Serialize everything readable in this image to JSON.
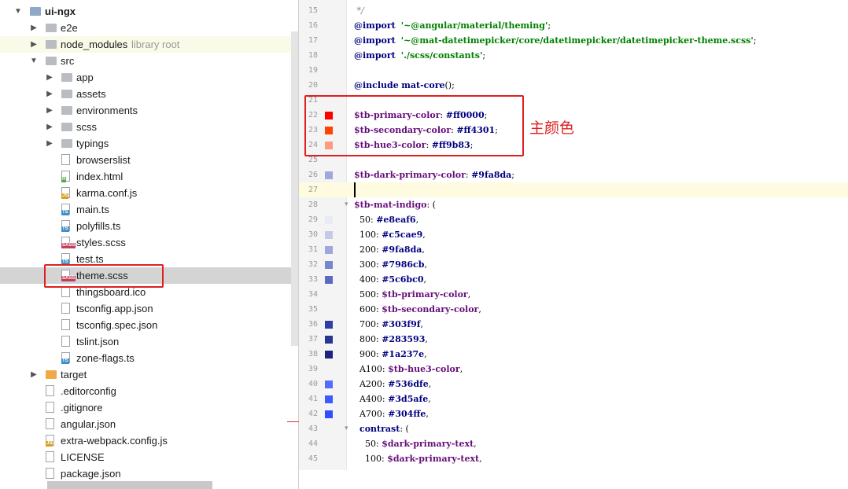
{
  "tree": {
    "rows": [
      {
        "label": "ui-ngx",
        "hint": "",
        "type": "root",
        "depth": 0,
        "arrow": "down",
        "bold": true
      },
      {
        "label": "e2e",
        "hint": "",
        "type": "folder",
        "depth": 1,
        "arrow": "right"
      },
      {
        "label": "node_modules",
        "hint": "library root",
        "type": "folder",
        "depth": 1,
        "arrow": "right"
      },
      {
        "label": "src",
        "hint": "",
        "type": "folder",
        "depth": 1,
        "arrow": "down"
      },
      {
        "label": "app",
        "hint": "",
        "type": "folder",
        "depth": 2,
        "arrow": "right"
      },
      {
        "label": "assets",
        "hint": "",
        "type": "folder",
        "depth": 2,
        "arrow": "right"
      },
      {
        "label": "environments",
        "hint": "",
        "type": "folder",
        "depth": 2,
        "arrow": "right"
      },
      {
        "label": "scss",
        "hint": "",
        "type": "folder",
        "depth": 2,
        "arrow": "right"
      },
      {
        "label": "typings",
        "hint": "",
        "type": "folder",
        "depth": 2,
        "arrow": "right"
      },
      {
        "label": "browserslist",
        "hint": "",
        "type": "file",
        "depth": 2,
        "arrow": "",
        "badge": "",
        "badgeColor": ""
      },
      {
        "label": "index.html",
        "hint": "",
        "type": "file",
        "depth": 2,
        "arrow": "",
        "badge": "H",
        "badgeColor": "#5aa845"
      },
      {
        "label": "karma.conf.js",
        "hint": "",
        "type": "file",
        "depth": 2,
        "arrow": "",
        "badge": "JS",
        "badgeColor": "#d8a020"
      },
      {
        "label": "main.ts",
        "hint": "",
        "type": "file",
        "depth": 2,
        "arrow": "",
        "badge": "TS",
        "badgeColor": "#3f8fc8"
      },
      {
        "label": "polyfills.ts",
        "hint": "",
        "type": "file",
        "depth": 2,
        "arrow": "",
        "badge": "TS",
        "badgeColor": "#3f8fc8"
      },
      {
        "label": "styles.scss",
        "hint": "",
        "type": "file",
        "depth": 2,
        "arrow": "",
        "badge": "SASS",
        "badgeColor": "#c0405a"
      },
      {
        "label": "test.ts",
        "hint": "",
        "type": "file",
        "depth": 2,
        "arrow": "",
        "badge": "TS",
        "badgeColor": "#3f8fc8"
      },
      {
        "label": "theme.scss",
        "hint": "",
        "type": "file",
        "depth": 2,
        "arrow": "",
        "badge": "SASS",
        "badgeColor": "#c0405a",
        "selected": true
      },
      {
        "label": "thingsboard.ico",
        "hint": "",
        "type": "file",
        "depth": 2,
        "arrow": "",
        "badge": "",
        "badgeColor": ""
      },
      {
        "label": "tsconfig.app.json",
        "hint": "",
        "type": "file",
        "depth": 2,
        "arrow": "",
        "badge": "",
        "badgeColor": ""
      },
      {
        "label": "tsconfig.spec.json",
        "hint": "",
        "type": "file",
        "depth": 2,
        "arrow": "",
        "badge": "",
        "badgeColor": ""
      },
      {
        "label": "tslint.json",
        "hint": "",
        "type": "file",
        "depth": 2,
        "arrow": "",
        "badge": "",
        "badgeColor": ""
      },
      {
        "label": "zone-flags.ts",
        "hint": "",
        "type": "file",
        "depth": 2,
        "arrow": "",
        "badge": "TS",
        "badgeColor": "#3f8fc8"
      },
      {
        "label": "target",
        "hint": "",
        "type": "folder-orange",
        "depth": 1,
        "arrow": "right"
      },
      {
        "label": ".editorconfig",
        "hint": "",
        "type": "file",
        "depth": 1,
        "arrow": "",
        "badge": "",
        "badgeColor": ""
      },
      {
        "label": ".gitignore",
        "hint": "",
        "type": "file",
        "depth": 1,
        "arrow": "",
        "badge": "",
        "badgeColor": ""
      },
      {
        "label": "angular.json",
        "hint": "",
        "type": "file",
        "depth": 1,
        "arrow": "",
        "badge": "",
        "badgeColor": ""
      },
      {
        "label": "extra-webpack.config.js",
        "hint": "",
        "type": "file",
        "depth": 1,
        "arrow": "",
        "badge": "JS",
        "badgeColor": "#d8a020"
      },
      {
        "label": "LICENSE",
        "hint": "",
        "type": "file",
        "depth": 1,
        "arrow": "",
        "badge": "",
        "badgeColor": ""
      },
      {
        "label": "package.json",
        "hint": "",
        "type": "file",
        "depth": 1,
        "arrow": "",
        "badge": "",
        "badgeColor": ""
      }
    ]
  },
  "editor": {
    "lines": [
      {
        "n": "15",
        "swatch": "",
        "fold": "",
        "tokens": [
          [
            "cm",
            " */"
          ]
        ]
      },
      {
        "n": "16",
        "swatch": "",
        "fold": "",
        "tokens": [
          [
            "kw",
            "@import"
          ],
          [
            "",
            "  "
          ],
          [
            "str",
            "'~@angular/material/theming'"
          ],
          [
            "",
            ";"
          ]
        ]
      },
      {
        "n": "17",
        "swatch": "",
        "fold": "",
        "tokens": [
          [
            "kw",
            "@import"
          ],
          [
            "",
            "  "
          ],
          [
            "str",
            "'~@mat-datetimepicker/core/datetimepicker/datetimepicker-theme.scss'"
          ],
          [
            "",
            ";"
          ]
        ]
      },
      {
        "n": "18",
        "swatch": "",
        "fold": "",
        "tokens": [
          [
            "kw",
            "@import"
          ],
          [
            "",
            "  "
          ],
          [
            "str",
            "'./scss/constants'"
          ],
          [
            "",
            ";"
          ]
        ]
      },
      {
        "n": "19",
        "swatch": "",
        "fold": "",
        "tokens": []
      },
      {
        "n": "20",
        "swatch": "",
        "fold": "",
        "tokens": [
          [
            "kw",
            "@include"
          ],
          [
            "",
            " "
          ],
          [
            "kw",
            "mat-core"
          ],
          [
            "",
            "();"
          ]
        ]
      },
      {
        "n": "21",
        "swatch": "",
        "fold": "",
        "tokens": []
      },
      {
        "n": "22",
        "swatch": "#ff0000",
        "fold": "",
        "tokens": [
          [
            "var",
            "$tb-primary-color"
          ],
          [
            "",
            ": "
          ],
          [
            "kw",
            "#ff0000"
          ],
          [
            "",
            ";"
          ]
        ]
      },
      {
        "n": "23",
        "swatch": "#ff4301",
        "fold": "",
        "tokens": [
          [
            "var",
            "$tb-secondary-color"
          ],
          [
            "",
            ": "
          ],
          [
            "kw",
            "#ff4301"
          ],
          [
            "",
            ";"
          ]
        ]
      },
      {
        "n": "24",
        "swatch": "#ff9b83",
        "fold": "",
        "tokens": [
          [
            "var",
            "$tb-hue3-color"
          ],
          [
            "",
            ": "
          ],
          [
            "kw",
            "#ff9b83"
          ],
          [
            "",
            ";"
          ]
        ]
      },
      {
        "n": "25",
        "swatch": "",
        "fold": "",
        "tokens": []
      },
      {
        "n": "26",
        "swatch": "#9fa8da",
        "fold": "",
        "tokens": [
          [
            "var",
            "$tb-dark-primary-color"
          ],
          [
            "",
            ": "
          ],
          [
            "kw",
            "#9fa8da"
          ],
          [
            "",
            ";"
          ]
        ]
      },
      {
        "n": "27",
        "swatch": "",
        "fold": "",
        "tokens": [],
        "caret": true
      },
      {
        "n": "28",
        "swatch": "",
        "fold": "▾",
        "tokens": [
          [
            "var",
            "$tb-mat-indigo"
          ],
          [
            "",
            ": ("
          ]
        ]
      },
      {
        "n": "29",
        "swatch": "#e8eaf6",
        "fold": "",
        "tokens": [
          [
            "",
            "  50: "
          ],
          [
            "kw",
            "#e8eaf6"
          ],
          [
            "",
            ","
          ]
        ]
      },
      {
        "n": "30",
        "swatch": "#c5cae9",
        "fold": "",
        "tokens": [
          [
            "",
            "  100: "
          ],
          [
            "kw",
            "#c5cae9"
          ],
          [
            "",
            ","
          ]
        ]
      },
      {
        "n": "31",
        "swatch": "#9fa8da",
        "fold": "",
        "tokens": [
          [
            "",
            "  200: "
          ],
          [
            "kw",
            "#9fa8da"
          ],
          [
            "",
            ","
          ]
        ]
      },
      {
        "n": "32",
        "swatch": "#7986cb",
        "fold": "",
        "tokens": [
          [
            "",
            "  300: "
          ],
          [
            "kw",
            "#7986cb"
          ],
          [
            "",
            ","
          ]
        ]
      },
      {
        "n": "33",
        "swatch": "#5c6bc0",
        "fold": "",
        "tokens": [
          [
            "",
            "  400: "
          ],
          [
            "kw",
            "#5c6bc0"
          ],
          [
            "",
            ","
          ]
        ]
      },
      {
        "n": "34",
        "swatch": "",
        "fold": "",
        "tokens": [
          [
            "",
            "  500: "
          ],
          [
            "var",
            "$tb-primary-color"
          ],
          [
            "",
            ","
          ]
        ]
      },
      {
        "n": "35",
        "swatch": "",
        "fold": "",
        "tokens": [
          [
            "",
            "  600: "
          ],
          [
            "var",
            "$tb-secondary-color"
          ],
          [
            "",
            ","
          ]
        ]
      },
      {
        "n": "36",
        "swatch": "#303f9f",
        "fold": "",
        "tokens": [
          [
            "",
            "  700: "
          ],
          [
            "kw",
            "#303f9f"
          ],
          [
            "",
            ","
          ]
        ]
      },
      {
        "n": "37",
        "swatch": "#283593",
        "fold": "",
        "tokens": [
          [
            "",
            "  800: "
          ],
          [
            "kw",
            "#283593"
          ],
          [
            "",
            ","
          ]
        ]
      },
      {
        "n": "38",
        "swatch": "#1a237e",
        "fold": "",
        "tokens": [
          [
            "",
            "  900: "
          ],
          [
            "kw",
            "#1a237e"
          ],
          [
            "",
            ","
          ]
        ]
      },
      {
        "n": "39",
        "swatch": "",
        "fold": "",
        "tokens": [
          [
            "",
            "  A100: "
          ],
          [
            "var",
            "$tb-hue3-color"
          ],
          [
            "",
            ","
          ]
        ]
      },
      {
        "n": "40",
        "swatch": "#536dfe",
        "fold": "",
        "tokens": [
          [
            "",
            "  A200: "
          ],
          [
            "kw",
            "#536dfe"
          ],
          [
            "",
            ","
          ]
        ]
      },
      {
        "n": "41",
        "swatch": "#3d5afe",
        "fold": "",
        "tokens": [
          [
            "",
            "  A400: "
          ],
          [
            "kw",
            "#3d5afe"
          ],
          [
            "",
            ","
          ]
        ]
      },
      {
        "n": "42",
        "swatch": "#304ffe",
        "fold": "",
        "tokens": [
          [
            "",
            "  A700: "
          ],
          [
            "kw",
            "#304ffe"
          ],
          [
            "",
            ","
          ]
        ]
      },
      {
        "n": "43",
        "swatch": "",
        "fold": "▾",
        "tokens": [
          [
            "",
            "  "
          ],
          [
            "kw",
            "contrast"
          ],
          [
            "",
            ": ("
          ]
        ]
      },
      {
        "n": "44",
        "swatch": "",
        "fold": "",
        "tokens": [
          [
            "",
            "    50: "
          ],
          [
            "var",
            "$dark-primary-text"
          ],
          [
            "",
            ","
          ]
        ]
      },
      {
        "n": "45",
        "swatch": "",
        "fold": "",
        "tokens": [
          [
            "",
            "    100: "
          ],
          [
            "var",
            "$dark-primary-text"
          ],
          [
            "",
            ","
          ]
        ]
      }
    ]
  },
  "annotation": {
    "text": "主颜色",
    "color": "#e02020"
  }
}
